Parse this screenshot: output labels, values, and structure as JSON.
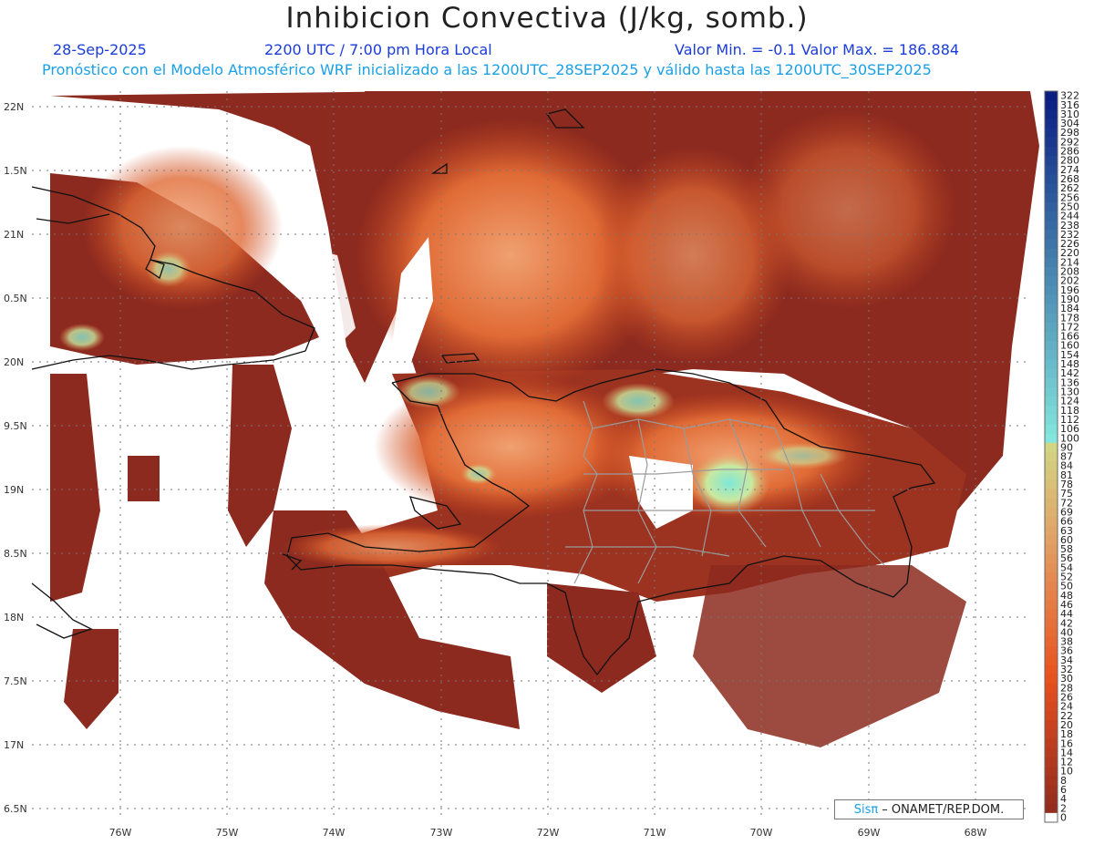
{
  "header": {
    "title": "Inhibicion Convectiva (J/kg, somb.)",
    "date": "28-Sep-2025",
    "time": "2200 UTC / 7:00 pm Hora Local",
    "minmax": "Valor Min. = -0.1  Valor Max. = 186.884",
    "model_line": "Pronóstico con el Modelo Atmosférico WRF inicializado a las 1200UTC_28SEP2025 y válido hasta las  1200UTC_30SEP2025"
  },
  "axes": {
    "lat_labels": [
      "22N",
      "1.5N",
      "21N",
      "0.5N",
      "20N",
      "9.5N",
      "19N",
      "8.5N",
      "18N",
      "7.5N",
      "17N",
      "6.5N"
    ],
    "lon_labels": [
      "76W",
      "75W",
      "74W",
      "73W",
      "72W",
      "71W",
      "70W",
      "69W",
      "68W"
    ]
  },
  "colorbar": {
    "labels": [
      "322",
      "316",
      "310",
      "304",
      "298",
      "292",
      "286",
      "280",
      "274",
      "268",
      "262",
      "256",
      "250",
      "244",
      "238",
      "232",
      "226",
      "220",
      "214",
      "208",
      "202",
      "196",
      "190",
      "184",
      "178",
      "172",
      "166",
      "160",
      "154",
      "148",
      "142",
      "136",
      "130",
      "124",
      "118",
      "112",
      "106",
      "100",
      "90",
      "87",
      "84",
      "81",
      "78",
      "75",
      "72",
      "69",
      "66",
      "63",
      "60",
      "58",
      "56",
      "54",
      "52",
      "50",
      "48",
      "46",
      "44",
      "42",
      "40",
      "38",
      "36",
      "34",
      "32",
      "30",
      "28",
      "26",
      "24",
      "22",
      "20",
      "18",
      "16",
      "14",
      "12",
      "10",
      "8",
      "6",
      "4",
      "2",
      "0"
    ]
  },
  "credit": {
    "sis": "Sisπ",
    "text": "– ONAMET/REP.DOM."
  },
  "colors": {
    "ocean": "#ffffff",
    "field_low": "#8c2a1f",
    "field_mid": "#d9501f",
    "field_high": "#f0a070",
    "field_peak": "#7ee8d8",
    "coast": "#111111",
    "province": "#9a9a9a"
  }
}
